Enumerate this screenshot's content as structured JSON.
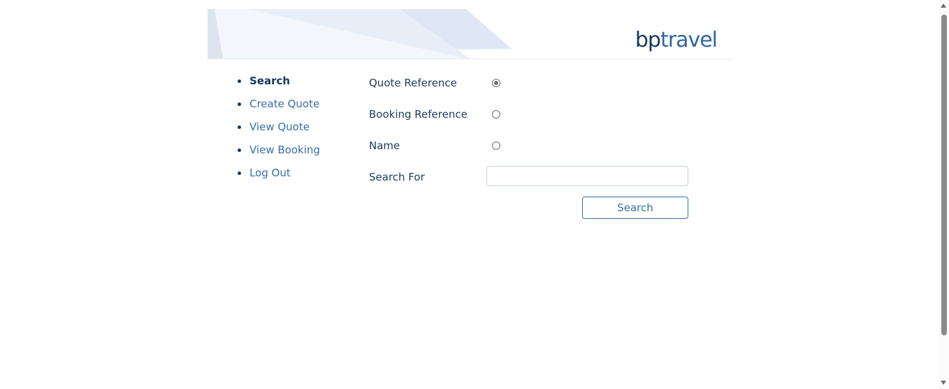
{
  "header": {
    "logo_bp": "bp",
    "logo_travel": "travel"
  },
  "nav": {
    "items": [
      {
        "label": "Search",
        "active": true
      },
      {
        "label": "Create Quote",
        "active": false
      },
      {
        "label": "View Quote",
        "active": false
      },
      {
        "label": "View Booking",
        "active": false
      },
      {
        "label": "Log Out",
        "active": false
      }
    ]
  },
  "search_form": {
    "options": [
      {
        "label": "Quote Reference",
        "checked": true
      },
      {
        "label": "Booking Reference",
        "checked": false
      },
      {
        "label": "Name",
        "checked": false
      }
    ],
    "search_for_label": "Search For",
    "search_for_value": "",
    "search_button_label": "Search"
  },
  "colors": {
    "brand_dark": "#14375e",
    "brand_link": "#3a6ea5",
    "banner_tint": "#e6ecf6"
  }
}
